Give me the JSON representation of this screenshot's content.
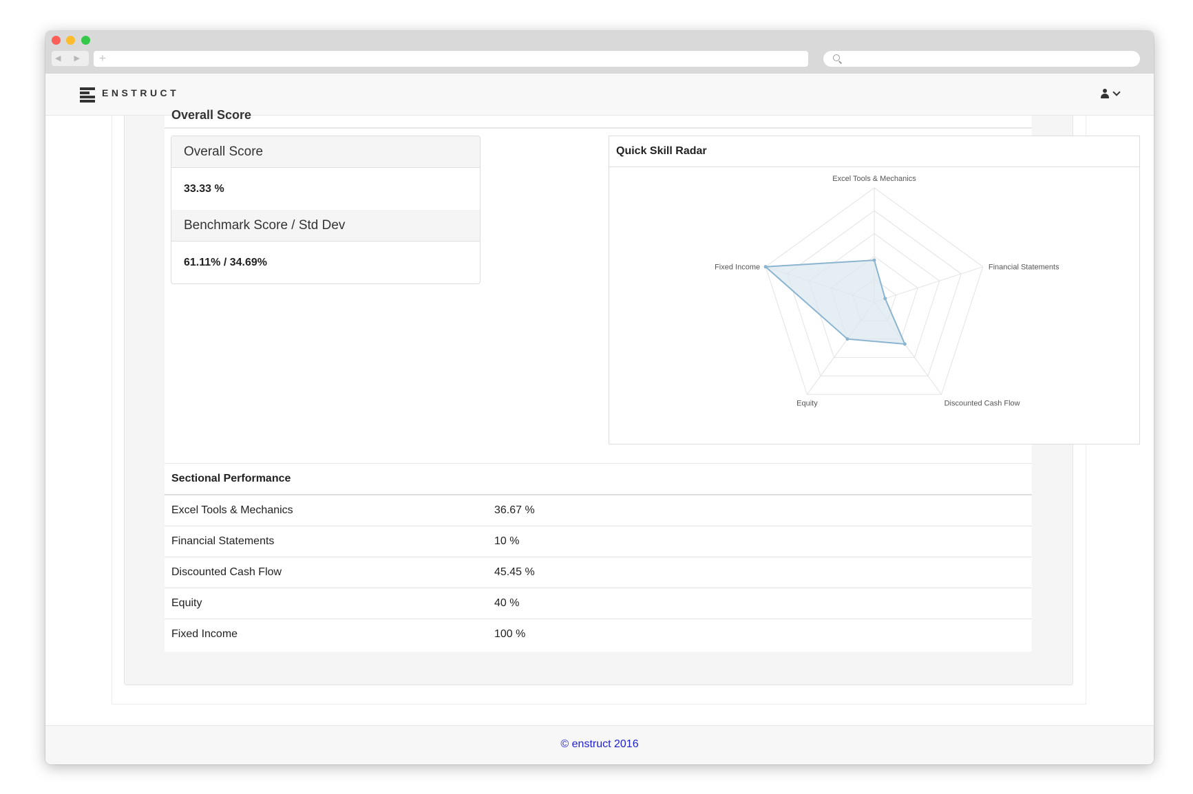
{
  "browser": {
    "nav_arrows": "◀ ▶",
    "new_tab": "+"
  },
  "header": {
    "brand": "ENSTRUCT"
  },
  "section_title": "Overall Score",
  "overall": {
    "heading": "Overall Score",
    "value": "33.33 %",
    "benchmark_heading": "Benchmark Score / Std Dev",
    "benchmark_value": "61.11% / 34.69%"
  },
  "radar": {
    "title": "Quick Skill Radar",
    "axes": [
      "Excel Tools & Mechanics",
      "Financial Statements",
      "Discounted Cash Flow",
      "Equity",
      "Fixed Income"
    ],
    "values": [
      36.67,
      10,
      45.45,
      40,
      100
    ],
    "max": 100,
    "levels": 5,
    "fill_color": "#dce8ef",
    "line_color": "#8ab4cf",
    "grid_color": "#e2e2e2"
  },
  "sectional": {
    "heading": "Sectional Performance",
    "rows": [
      {
        "section": "Excel Tools & Mechanics",
        "score": "36.67 %"
      },
      {
        "section": "Financial Statements",
        "score": "10 %"
      },
      {
        "section": "Discounted Cash Flow",
        "score": "45.45 %"
      },
      {
        "section": "Equity",
        "score": "40 %"
      },
      {
        "section": "Fixed Income",
        "score": "100 %"
      }
    ]
  },
  "footer": {
    "text": "© enstruct  2016"
  }
}
